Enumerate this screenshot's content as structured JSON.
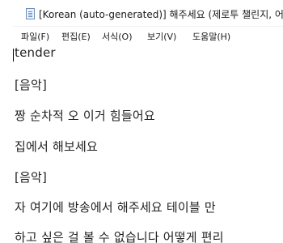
{
  "window": {
    "title": "[Korean (auto-generated)] 해주세요 (제로투 챌린지, 어휘"
  },
  "menu": {
    "items": [
      "파일(F)",
      "편집(E)",
      "서식(O)",
      "보기(V)",
      "도움말(H)"
    ]
  },
  "editor": {
    "lines": [
      "tender",
      "[음악]",
      "짱 순차적 오 이거 힘들어요",
      "집에서 해보세요",
      "[음악]",
      "자 여기에 방송에서 해주세요 테이블 만",
      "하고 싶은 걸 볼 수 없습니다 어떻게 편리"
    ]
  }
}
